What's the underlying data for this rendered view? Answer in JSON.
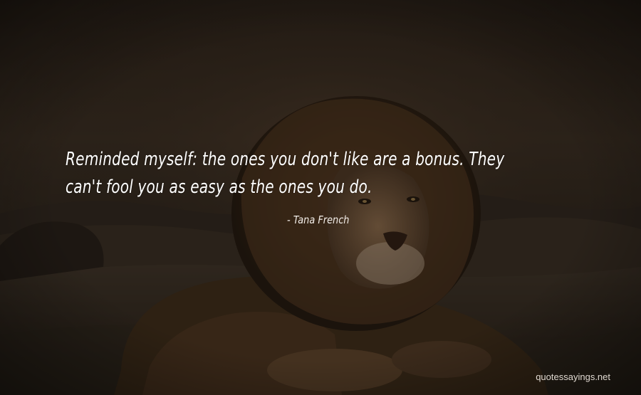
{
  "quote": {
    "line1": "Reminded myself: the ones you don't like are a bonus. They",
    "line2": "can't fool you as easy as the ones you do.",
    "author": "- Tana French"
  },
  "watermark": "quotessayings.net",
  "background": {
    "subject": "lion-lying-on-sand-at-dusk",
    "tint_color": "#2a2118"
  }
}
